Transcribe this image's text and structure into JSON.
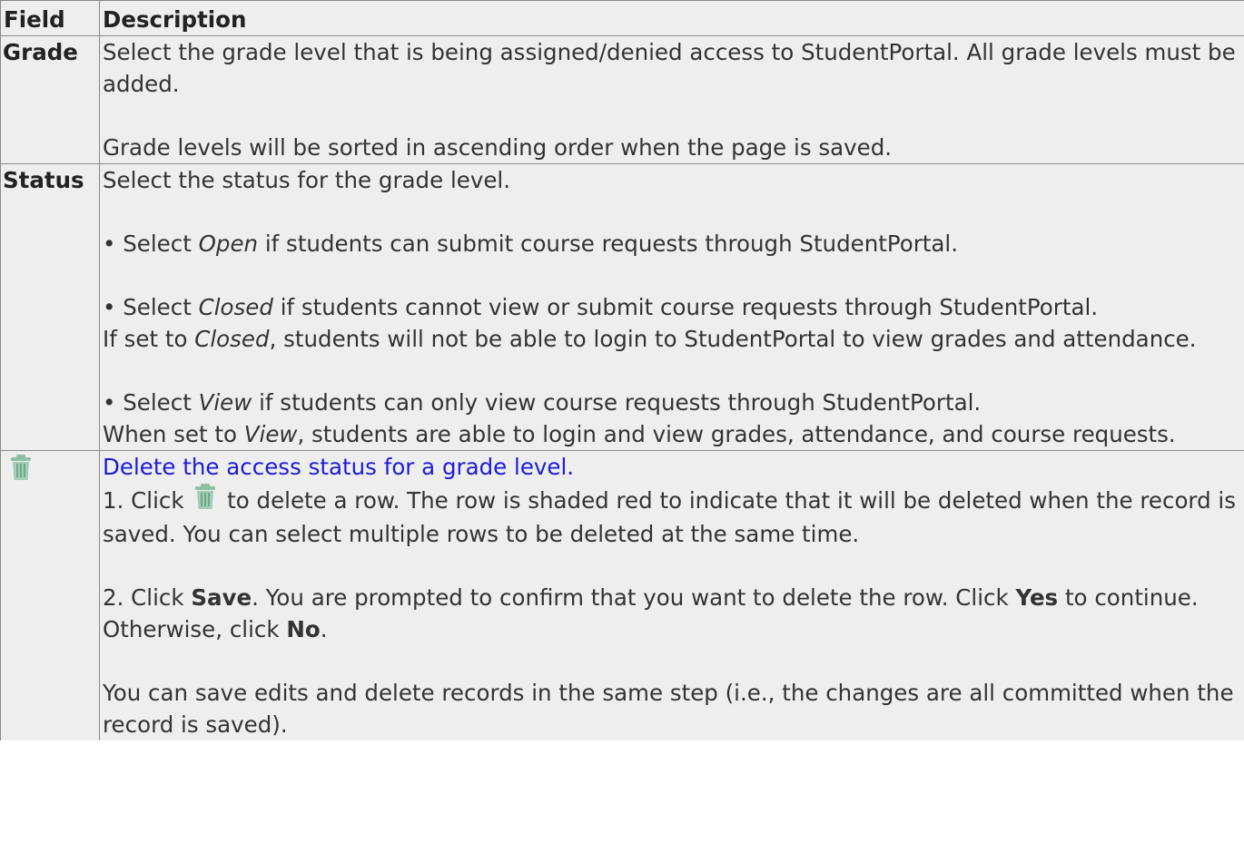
{
  "header": {
    "field": "Field",
    "description": "Description"
  },
  "rows": [
    {
      "field": "Grade",
      "p1": "Select the grade level that is being assigned/denied access to StudentPortal. All grade levels must be added.",
      "p2": "Grade levels will be sorted in ascending order when the page is saved."
    },
    {
      "field": "Status",
      "p1": "Select the status for the grade level.",
      "open_pre": "• Select ",
      "open_em": "Open",
      "open_post": " if students can submit course requests through StudentPortal.",
      "closed_pre": "• Select ",
      "closed_em": "Closed",
      "closed_post": " if students cannot view or submit course requests through StudentPortal.",
      "closed2_pre": "If set to ",
      "closed2_em": "Closed",
      "closed2_post": ", students will not be able to login to StudentPortal to view grades and attendance.",
      "view_pre": "• Select ",
      "view_em": "View",
      "view_post": " if students can only view course requests through StudentPortal.",
      "view2_pre": "When set to ",
      "view2_em": "View",
      "view2_post": ", students are able to login and view grades, attendance, and course requests."
    },
    {
      "field_icon": "trash-icon",
      "link": "Delete the access status for a grade level.",
      "s1_pre": "1. Click ",
      "s1_post": " to delete a row. The row is shaded red to indicate that it will be deleted when the record is saved. You can select multiple rows to be deleted at the same time.",
      "s2_pre": "2. Click ",
      "s2_b1": "Save",
      "s2_mid": ". You are prompted to confirm that you want to delete the row. Click ",
      "s2_b2": "Yes",
      "s2_mid2": " to continue. Otherwise, click ",
      "s2_b3": "No",
      "s2_end": ".",
      "note": "You can save edits and delete records in the same step (i.e., the changes are all committed when the record is saved)."
    }
  ],
  "colors": {
    "cell_bg": "#eeeeee",
    "border": "#8a8a8a",
    "link": "#1c1cd8",
    "icon": "#8fc0a6"
  }
}
